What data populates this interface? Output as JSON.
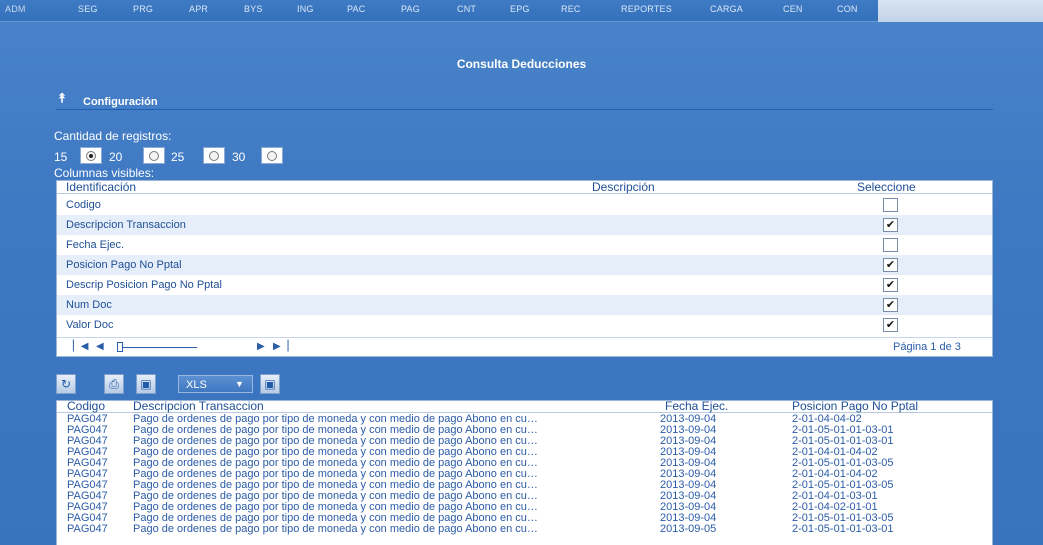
{
  "nav": {
    "items": [
      "ADM",
      "SEG",
      "PRG",
      "APR",
      "BYS",
      "ING",
      "PAC",
      "PAG",
      "CNT",
      "EPG",
      "REC",
      "REPORTES",
      "CARGA",
      "CEN",
      "CON"
    ]
  },
  "page": {
    "title": "Consulta Deducciones"
  },
  "config": {
    "section_title": "Configuración",
    "toggle_icon": "chevron-double-up-icon",
    "records_label": "Cantidad de registros:",
    "record_options": [
      {
        "label": "15",
        "selected": true
      },
      {
        "label": "20",
        "selected": false
      },
      {
        "label": "25",
        "selected": false
      },
      {
        "label": "30",
        "selected": false
      }
    ],
    "columns_label": "Columnas visibles:",
    "columns_table": {
      "headers": [
        "Identificación",
        "Descripción",
        "Seleccione"
      ],
      "rows": [
        {
          "label": "Codigo",
          "checked": false
        },
        {
          "label": "Descripcion Transaccion",
          "checked": true
        },
        {
          "label": "Fecha Ejec.",
          "checked": false
        },
        {
          "label": "Posicion Pago No Pptal",
          "checked": true
        },
        {
          "label": "Descrip Posicion Pago No Pptal",
          "checked": true
        },
        {
          "label": "Num Doc",
          "checked": true
        },
        {
          "label": "Valor Doc",
          "checked": true
        }
      ],
      "pager_text": "Página 1 de 3"
    }
  },
  "toolbar": {
    "export_format": "XLS",
    "icons": [
      "refresh-icon",
      "print-icon",
      "save-icon",
      "export-icon"
    ]
  },
  "grid": {
    "headers": [
      "Codigo",
      "Descripcion Transaccion",
      "Fecha Ejec.",
      "Posicion Pago No Pptal"
    ],
    "rows": [
      [
        "PAG047",
        "Pago de ordenes de pago por tipo de moneda y con medio de pago Abono en cu…",
        "2013-09-04",
        "2-01-04-04-02"
      ],
      [
        "PAG047",
        "Pago de ordenes de pago por tipo de moneda y con medio de pago Abono en cu…",
        "2013-09-04",
        "2-01-05-01-01-03-01"
      ],
      [
        "PAG047",
        "Pago de ordenes de pago por tipo de moneda y con medio de pago Abono en cu…",
        "2013-09-04",
        "2-01-05-01-01-03-01"
      ],
      [
        "PAG047",
        "Pago de ordenes de pago por tipo de moneda y con medio de pago Abono en cu…",
        "2013-09-04",
        "2-01-04-01-04-02"
      ],
      [
        "PAG047",
        "Pago de ordenes de pago por tipo de moneda y con medio de pago Abono en cu…",
        "2013-09-04",
        "2-01-05-01-01-03-05"
      ],
      [
        "PAG047",
        "Pago de ordenes de pago por tipo de moneda y con medio de pago Abono en cu…",
        "2013-09-04",
        "2-01-04-01-04-02"
      ],
      [
        "PAG047",
        "Pago de ordenes de pago por tipo de moneda y con medio de pago Abono en cu…",
        "2013-09-04",
        "2-01-05-01-01-03-05"
      ],
      [
        "PAG047",
        "Pago de ordenes de pago por tipo de moneda y con medio de pago Abono en cu…",
        "2013-09-04",
        "2-01-04-01-03-01"
      ],
      [
        "PAG047",
        "Pago de ordenes de pago por tipo de moneda y con medio de pago Abono en cu…",
        "2013-09-04",
        "2-01-04-02-01-01"
      ],
      [
        "PAG047",
        "Pago de ordenes de pago por tipo de moneda y con medio de pago Abono en cu…",
        "2013-09-04",
        "2-01-05-01-01-03-05"
      ],
      [
        "PAG047",
        "Pago de ordenes de pago por tipo de moneda y con medio de pago Abono en cu…",
        "2013-09-05",
        "2-01-05-01-01-03-01"
      ]
    ]
  },
  "colors": {
    "background": "#3d78c2",
    "link_text": "#1f4f96",
    "row_alt": "#e6eef9"
  }
}
